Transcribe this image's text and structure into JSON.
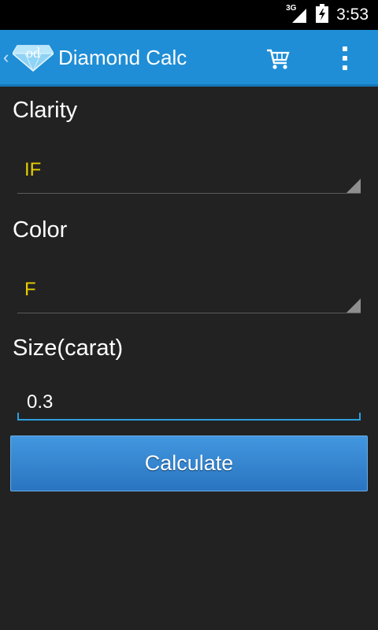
{
  "status_bar": {
    "network": "3G",
    "time": "3:53"
  },
  "action_bar": {
    "logo_text": "od",
    "title": "Diamond Calc",
    "cart_icon": "cart-icon",
    "overflow_icon": "overflow-menu-icon"
  },
  "form": {
    "clarity": {
      "label": "Clarity",
      "selected": "IF"
    },
    "color": {
      "label": "Color",
      "selected": "F"
    },
    "size": {
      "label": "Size(carat)",
      "value": "0.3"
    },
    "calculate_label": "Calculate"
  },
  "colors": {
    "action_bar": "#1f8ed6",
    "background": "#222222",
    "spinner_value": "#e6cc00",
    "accent": "#2d9fde"
  }
}
